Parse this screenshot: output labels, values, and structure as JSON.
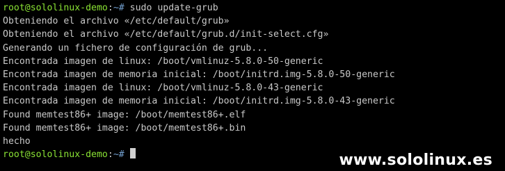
{
  "terminal": {
    "prompt": {
      "user_host": "root@sololinux-demo",
      "sep": ":",
      "path": "~#",
      "command": " sudo update-grub"
    },
    "output_lines": [
      "Obteniendo el archivo «/etc/default/grub»",
      "Obteniendo el archivo «/etc/default/grub.d/init-select.cfg»",
      "Generando un fichero de configuración de grub...",
      "Encontrada imagen de linux: /boot/vmlinuz-5.8.0-50-generic",
      "Encontrada imagen de memoria inicial: /boot/initrd.img-5.8.0-50-generic",
      "Encontrada imagen de linux: /boot/vmlinuz-5.8.0-43-generic",
      "Encontrada imagen de memoria inicial: /boot/initrd.img-5.8.0-43-generic",
      "Found memtest86+ image: /boot/memtest86+.elf",
      "Found memtest86+ image: /boot/memtest86+.bin",
      "hecho"
    ],
    "final_prompt": {
      "user_host": "root@sololinux-demo",
      "sep": ":",
      "path": "~#",
      "command": " "
    }
  },
  "watermark": "www.sololinux.es",
  "colors": {
    "background": "#000000",
    "text": "#c9c9c9",
    "prompt_user": "#8ae234",
    "prompt_path": "#729fcf"
  }
}
